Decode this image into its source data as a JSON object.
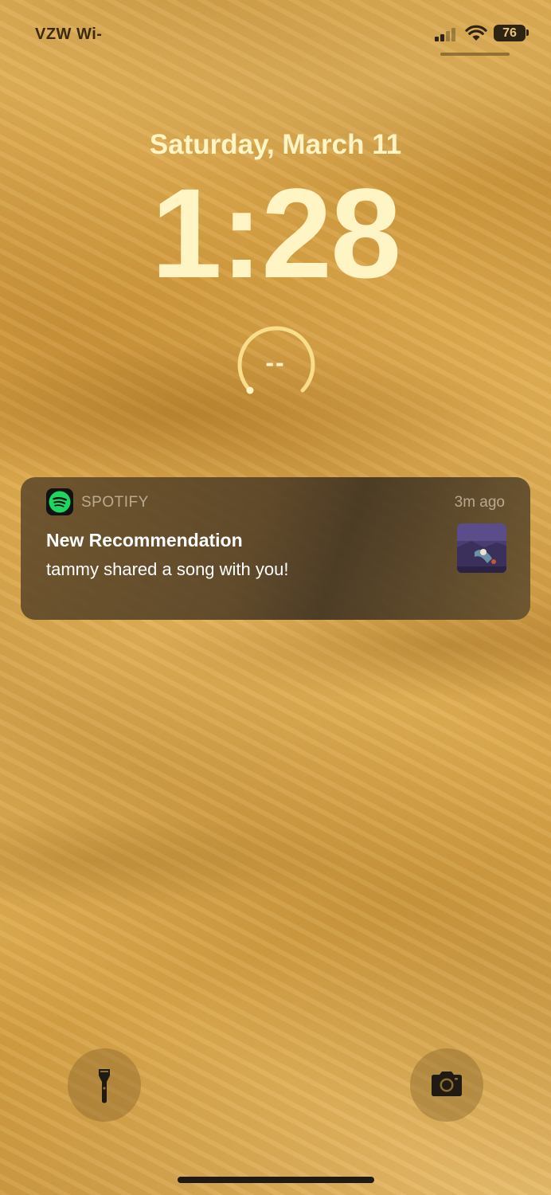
{
  "status_bar": {
    "carrier": "VZW Wi-",
    "battery": "76",
    "signal_icon": "cellular-signal-icon",
    "wifi_icon": "wifi-icon"
  },
  "lock_screen": {
    "date": "Saturday, March 11",
    "time": "1:28",
    "widget_value": "--"
  },
  "notification": {
    "app_name": "SPOTIFY",
    "time_ago": "3m ago",
    "title": "New Recommendation",
    "body": "tammy shared a song with you!",
    "app_icon": "spotify-icon"
  },
  "quick_actions": {
    "left": "flashlight-icon",
    "right": "camera-icon"
  },
  "colors": {
    "spotify_green": "#1ed760",
    "clock_text": "#fff4c4"
  }
}
